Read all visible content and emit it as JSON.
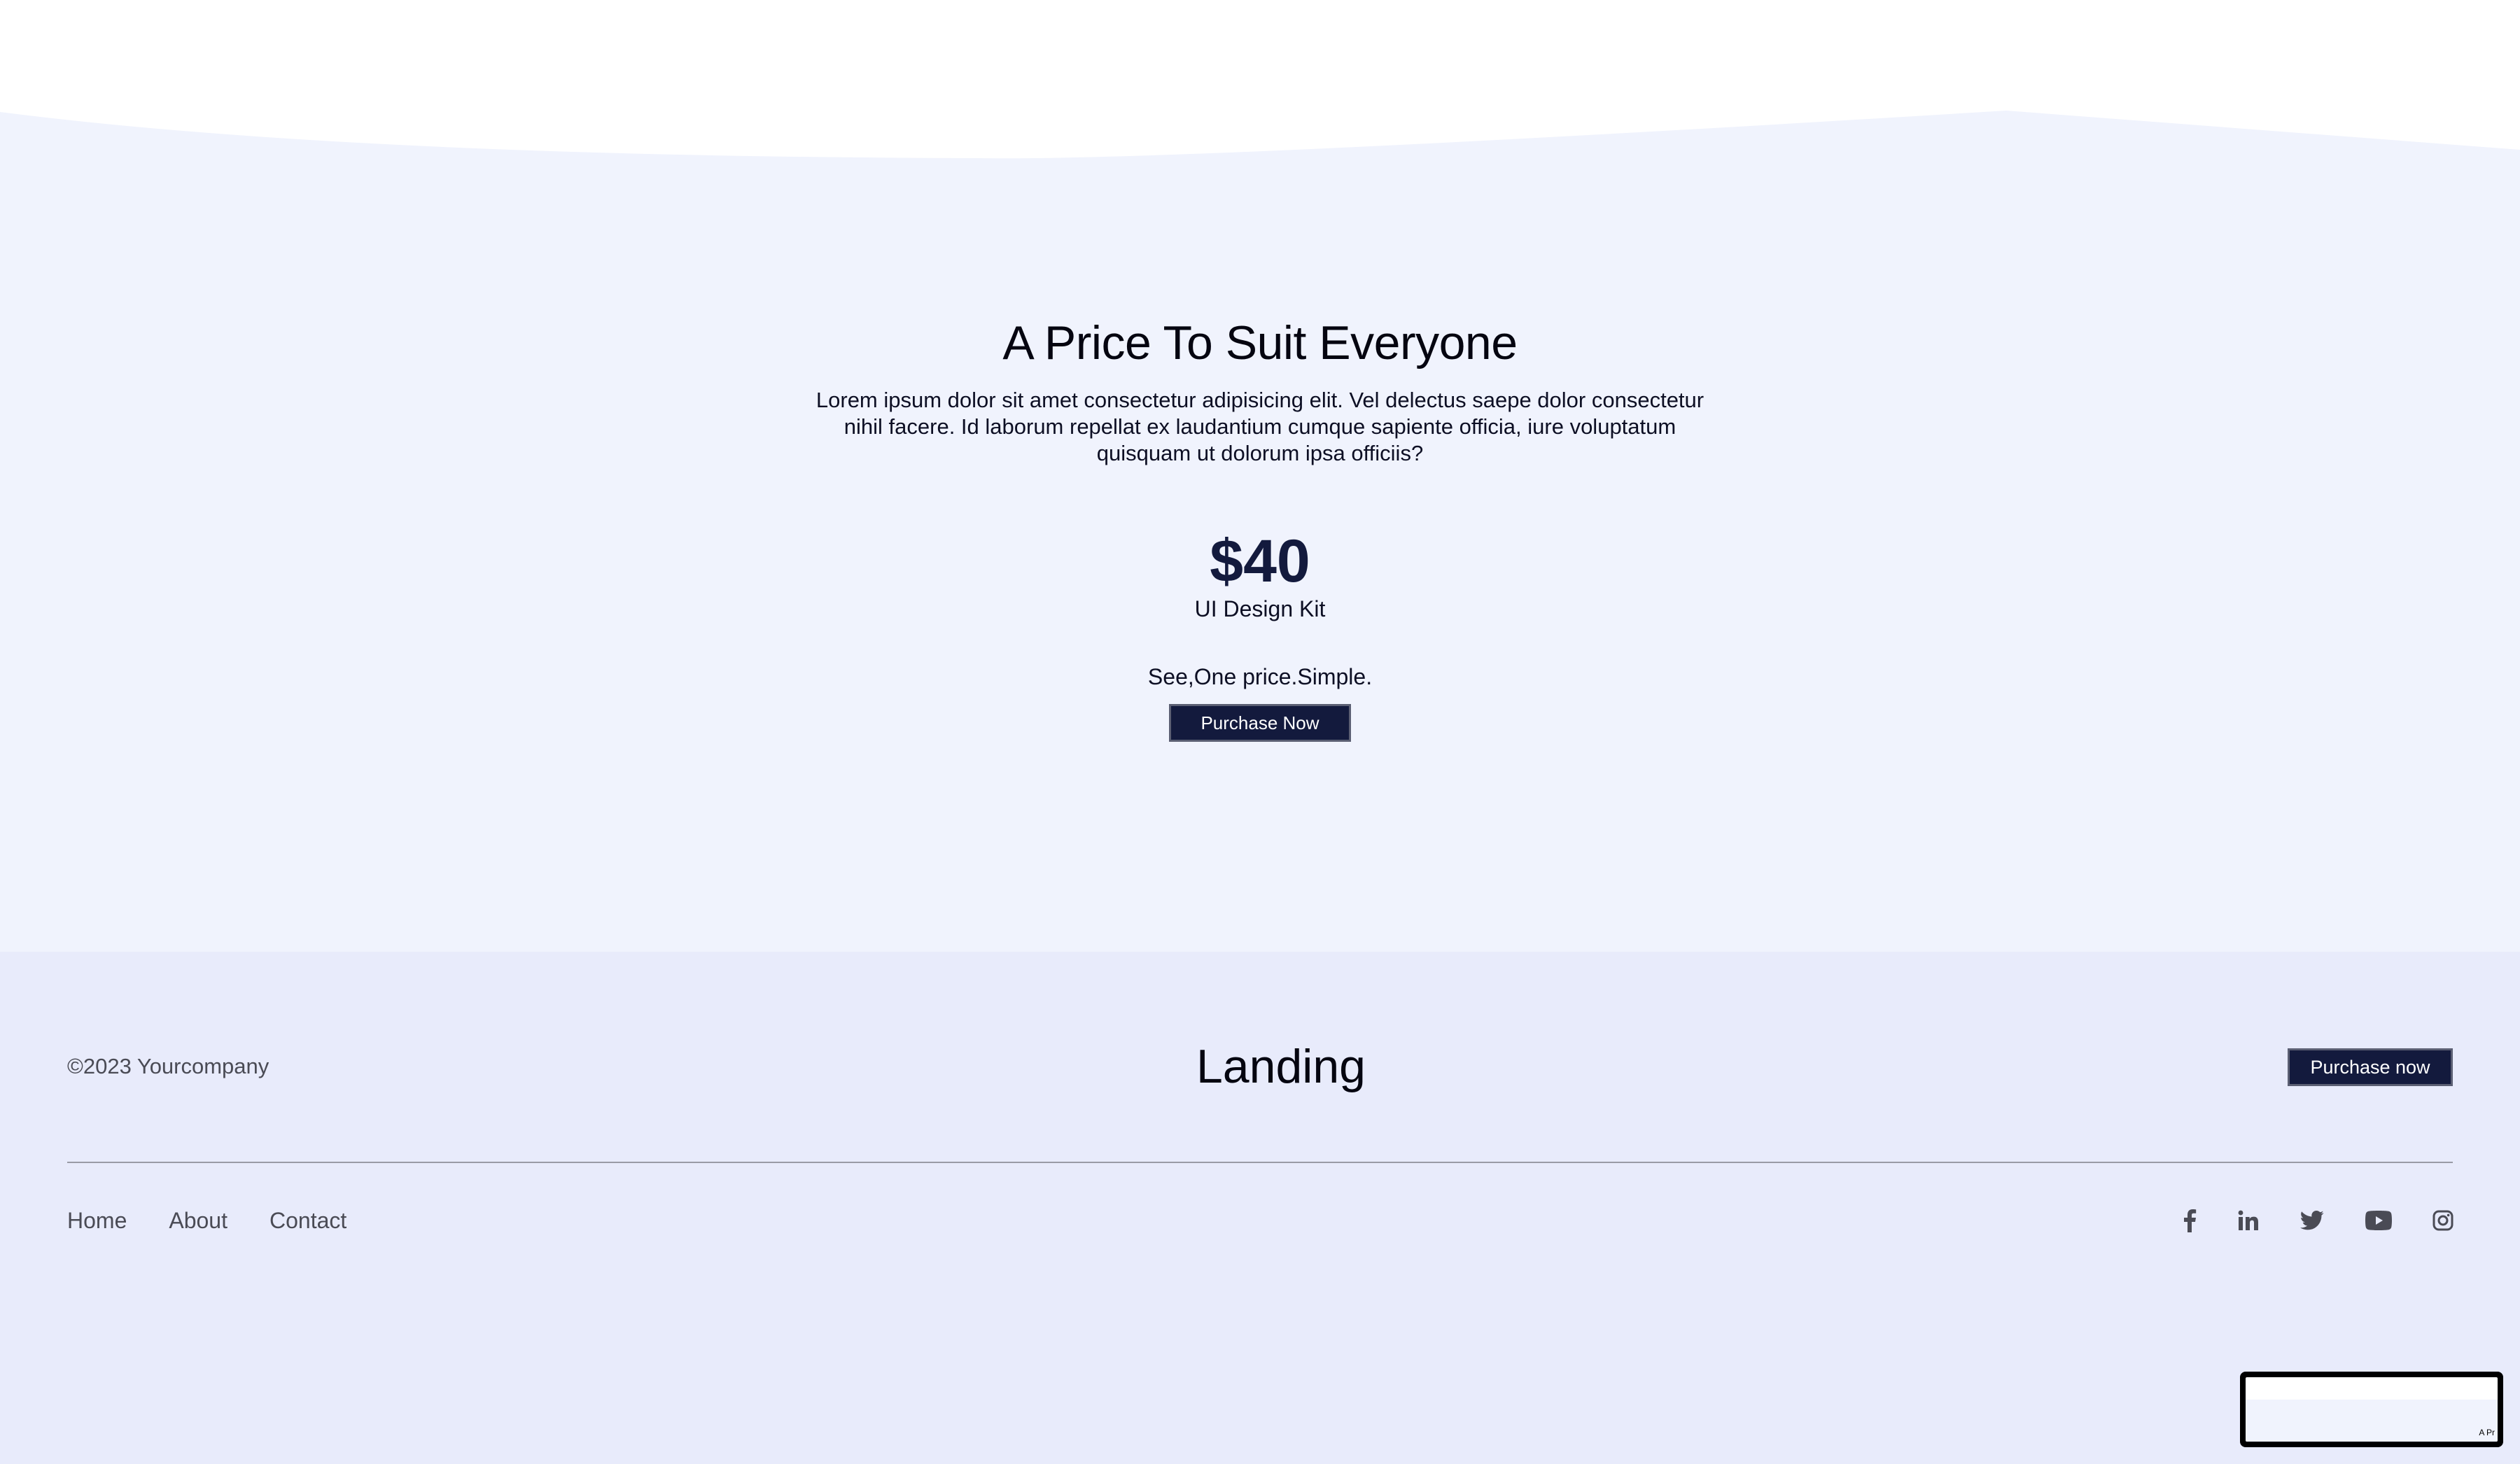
{
  "pricing": {
    "title": "A Price To Suit Everyone",
    "description": "Lorem ipsum dolor sit amet consectetur adipisicing elit. Vel delectus saepe dolor consectetur nihil facere. Id laborum repellat ex laudantium cumque sapiente officia, iure voluptatum quisquam ut dolorum ipsa officiis?",
    "price": "$40",
    "product": "UI Design Kit",
    "tagline": "See,One price.Simple.",
    "button_label": "Purchase Now"
  },
  "footer": {
    "copyright": "©2023 Yourcompany",
    "brand": "Landing",
    "button_label": "Purchase now",
    "nav": [
      "Home",
      "About",
      "Contact"
    ],
    "social_icons": [
      "facebook-icon",
      "linkedin-icon",
      "twitter-icon",
      "youtube-icon",
      "instagram-icon"
    ]
  },
  "preview_widget": {
    "text": "A Pr"
  },
  "colors": {
    "pricing_bg": "#f0f3fd",
    "footer_bg": "#e8ebfb",
    "accent": "#131a3d",
    "muted_text": "#4a4b55"
  }
}
